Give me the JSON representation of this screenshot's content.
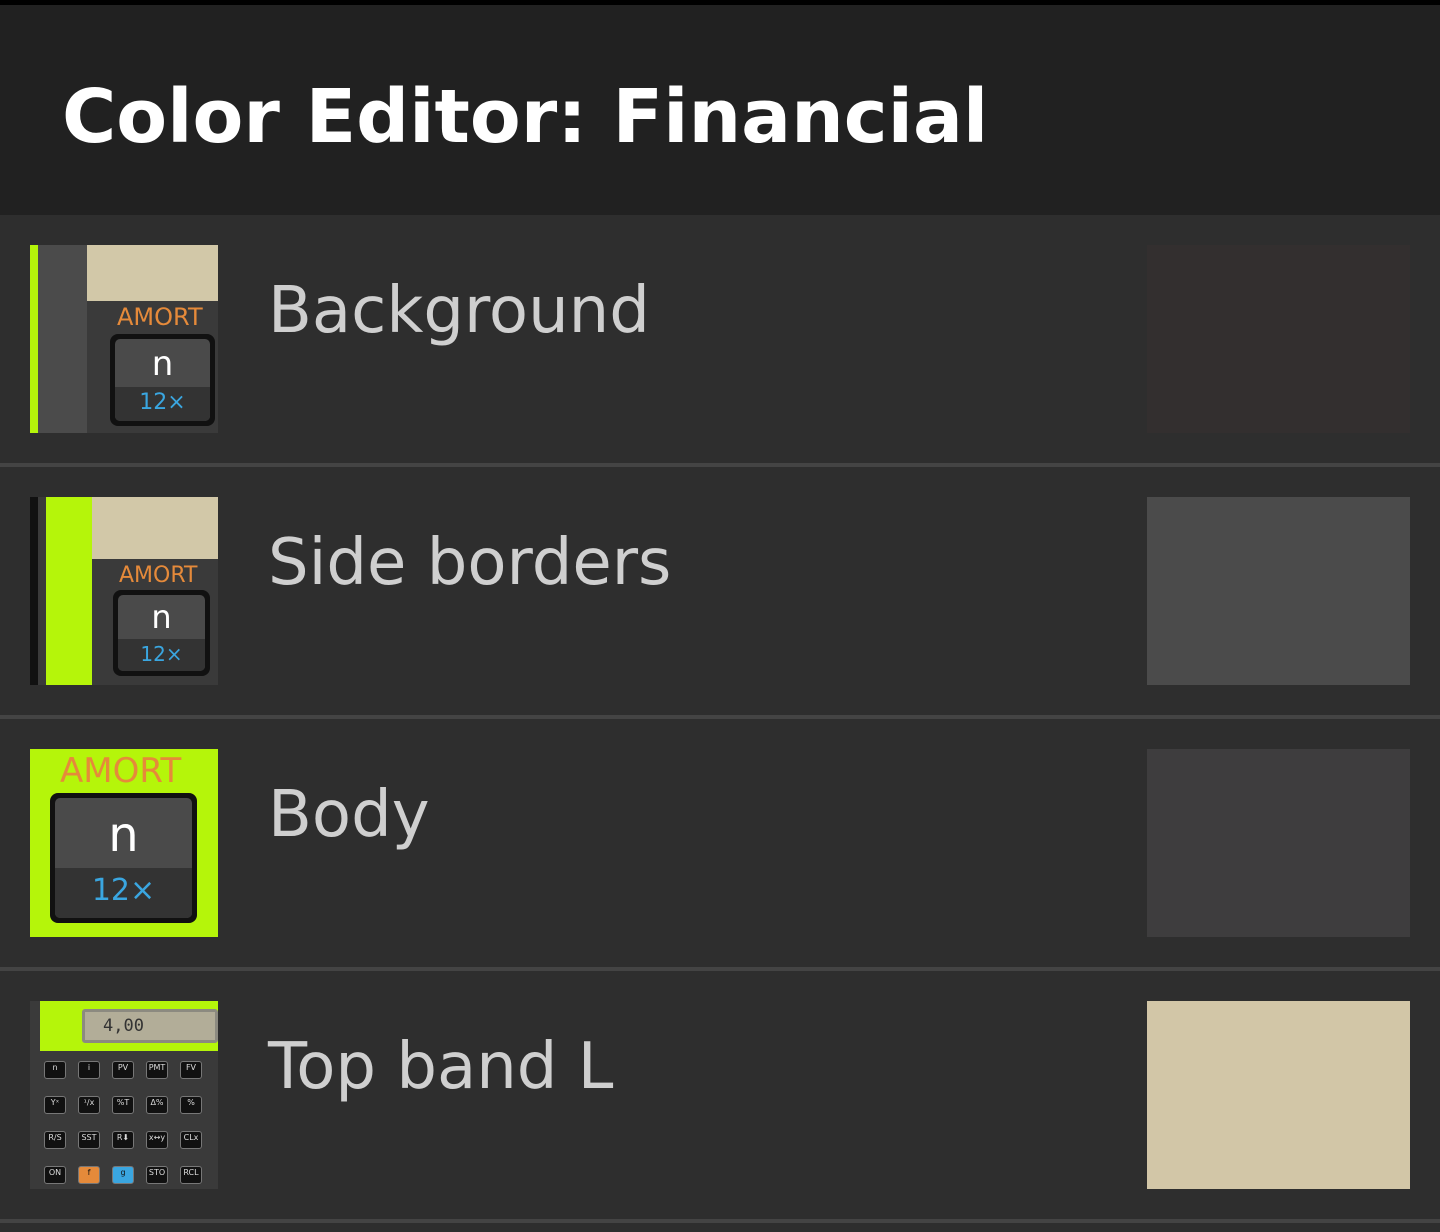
{
  "header": {
    "title": "Color Editor: Financial"
  },
  "preview": {
    "amort_label": "AMORT",
    "key_main": "n",
    "key_sub": "12×",
    "lcd_value": "4,00",
    "calc_keys": [
      "n",
      "i",
      "PV",
      "PMT",
      "FV",
      "Yˣ",
      "¹/x",
      "%T",
      "Δ%",
      "%",
      "R/S",
      "SST",
      "R⬇",
      "x↔y",
      "CLx",
      "ON",
      "f",
      "g",
      "STO",
      "RCL"
    ]
  },
  "colors": {
    "lime": "#b5f50a",
    "beige": "#d2c8a8",
    "orange": "#e58a3a",
    "blue": "#3aa6e0"
  },
  "items": [
    {
      "label": "Background",
      "swatch": "#332f2f"
    },
    {
      "label": "Side borders",
      "swatch": "#4b4b4b"
    },
    {
      "label": "Body",
      "swatch": "#3e3d3e"
    },
    {
      "label": "Top band L",
      "swatch": "#d2c6a7"
    }
  ]
}
